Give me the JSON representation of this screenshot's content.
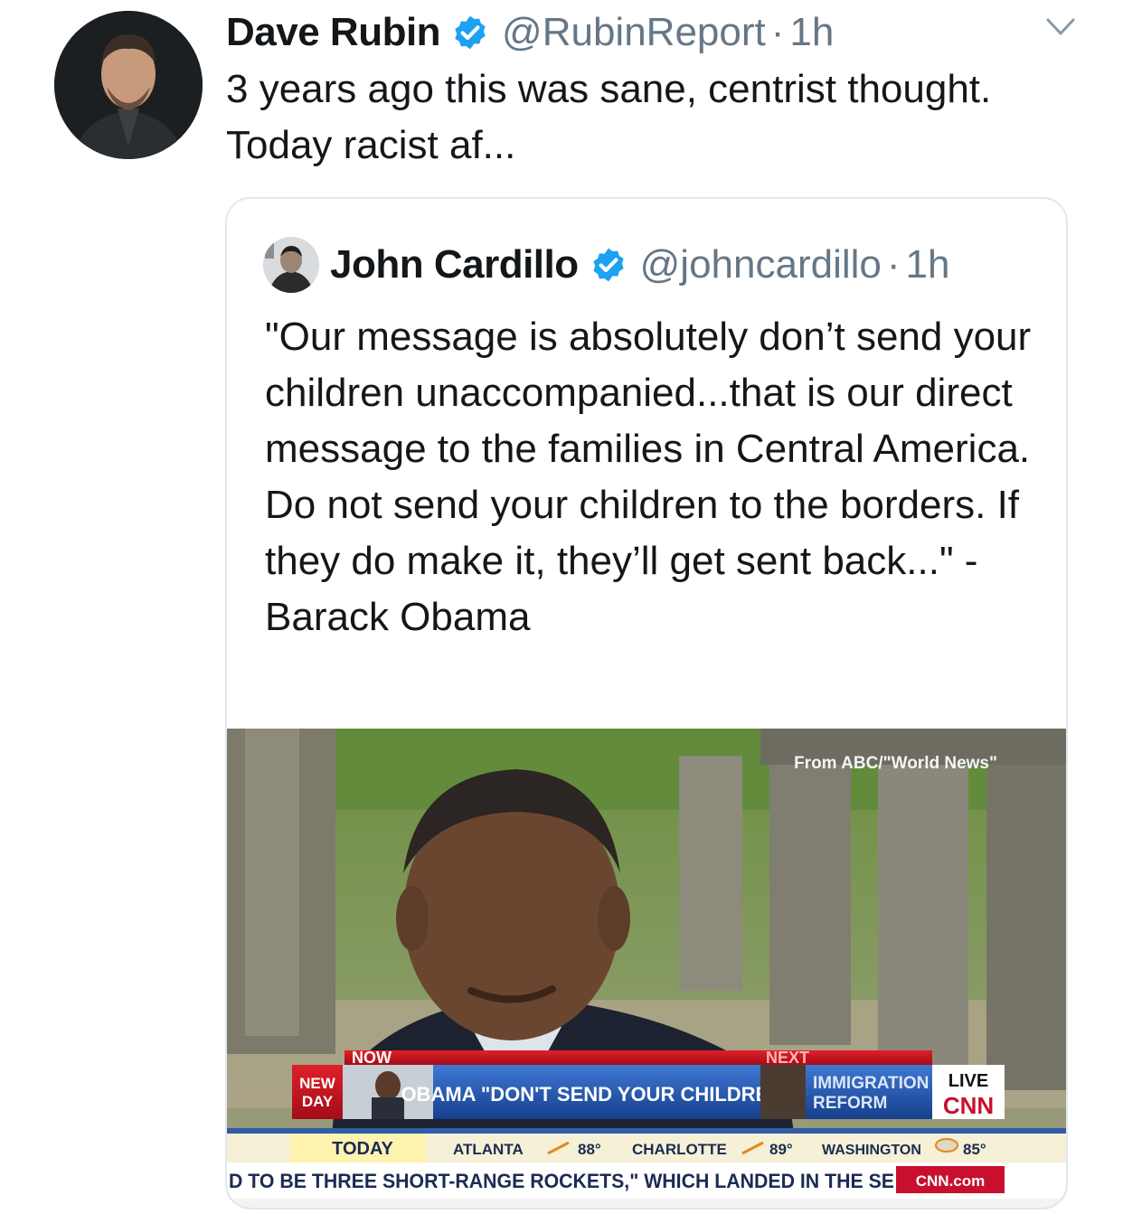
{
  "tweet": {
    "author_name": "Dave Rubin",
    "handle": "@RubinReport",
    "separator": "·",
    "time": "1h",
    "text": "3 years ago this was sane, centrist thought. Today racist af...",
    "icons": {
      "verified": "verified-badge-icon",
      "menu": "chevron-down-icon"
    },
    "colors": {
      "verified": "#1da1f2",
      "secondary_text": "#657786"
    }
  },
  "quoted_tweet": {
    "author_name": "John Cardillo",
    "handle": "@johncardillo",
    "separator": "·",
    "time": "1h",
    "text": "\"Our message is absolutely don’t send your children unaccompanied...that is our direct message to the families in Central America. Do not send your children to the borders. If they do make it, they’ll get sent back...\" - Barack Obama",
    "media": {
      "source_credit": "From ABC/\"World News\"",
      "now_label": "NOW",
      "next_label": "NEXT",
      "show_label": "NEW DAY",
      "headline": "OBAMA \"DON'T SEND YOUR CHILDREN\"",
      "next_topic": "IMMIGRATION REFORM",
      "live_label": "LIVE",
      "network_logo": "CNN",
      "weather": {
        "today": "TODAY",
        "cities": [
          {
            "city": "ATLANTA",
            "temp": "88°"
          },
          {
            "city": "CHARLOTTE",
            "temp": "89°"
          },
          {
            "city": "WASHINGTON",
            "temp": "85°"
          }
        ]
      },
      "ticker": "D TO BE THREE SHORT-RANGE ROCKETS,\" WHICH LANDED IN THE SE",
      "site": "CNN.com",
      "colors": {
        "red": "#c8102e",
        "blue": "#1e4fa3",
        "ticker_bg": "#fff3b0"
      }
    }
  }
}
